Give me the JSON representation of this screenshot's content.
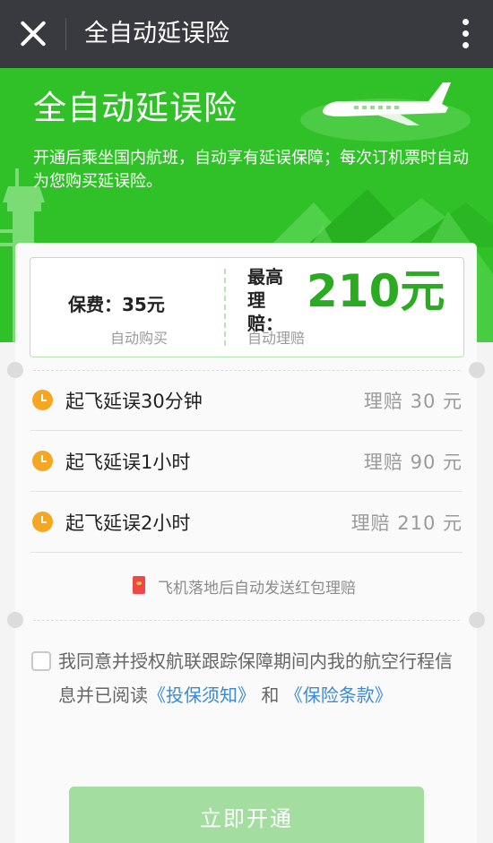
{
  "header": {
    "title": "全自动延误险"
  },
  "hero": {
    "title": "全自动延误险",
    "description": "开通后乘坐国内航班，自动享有延误保障；每次订机票时自动为您购买延误险。"
  },
  "coverage": {
    "fee_label": "保费：35元",
    "fee_sub": "自动购买",
    "max_label": "最高理赔：",
    "max_amount": "210元",
    "max_sub": "自动理赔"
  },
  "delay_rows": [
    {
      "label": "起飞延误30分钟",
      "amount": "理赔 30 元"
    },
    {
      "label": "起飞延误1小时",
      "amount": "理赔 90 元"
    },
    {
      "label": "起飞延误2小时",
      "amount": "理赔 210 元"
    }
  ],
  "notice": {
    "text": "飞机落地后自动发送红包理赔"
  },
  "agreement": {
    "text_before": "我同意并授权航联跟踪保障期间内我的航空行程信息并已阅读",
    "link1": "《投保须知》",
    "text_mid": "和",
    "link2": "《保险条款》"
  },
  "submit": {
    "label": "立即开通"
  },
  "colors": {
    "topbar": "#393a3f",
    "brand_green": "#2fc127",
    "amount_green": "#2aab22",
    "clock_orange": "#f5a623",
    "link_blue": "#3b8ad8",
    "button_disabled": "#a3dd9f"
  },
  "icons": [
    "close-icon",
    "more-icon",
    "clock-icon",
    "red-packet-icon",
    "checkbox"
  ]
}
